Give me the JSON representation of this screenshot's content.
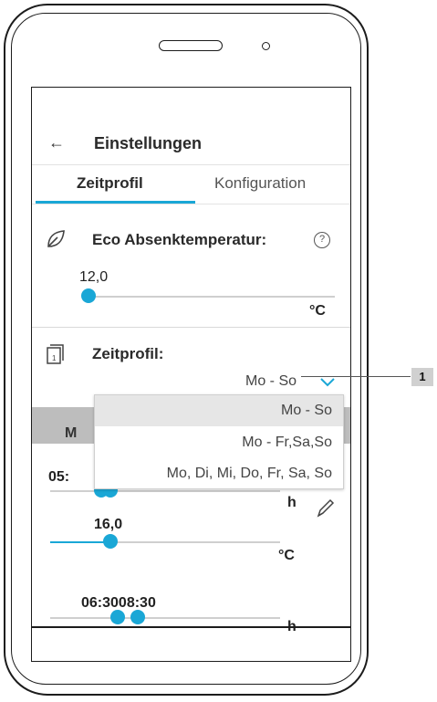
{
  "header": {
    "back_icon": "arrow-left-icon",
    "title": "Einstellungen"
  },
  "tabs": [
    {
      "label": "Zeitprofil",
      "active": true
    },
    {
      "label": "Konfiguration",
      "active": false
    }
  ],
  "eco": {
    "label": "Eco Absenktemperatur:",
    "value": "12,0",
    "unit": "°C",
    "icon": "leaf-icon",
    "help_icon": "question-icon",
    "help_glyph": "?"
  },
  "zeitprofil": {
    "label": "Zeitprofil:",
    "icon": "calendar-icon",
    "selected": "Mo - So",
    "options": [
      "Mo - So",
      "Mo - Fr,Sa,So",
      "Mo, Di, Mi, Do, Fr, Sa, So"
    ]
  },
  "day_header": "M",
  "period1": {
    "time": "05:",
    "unit": "h"
  },
  "period2": {
    "temp": "16,0",
    "unit": "°C"
  },
  "period3": {
    "time": "06:3008:30",
    "unit": "h"
  },
  "callout": {
    "number": "1"
  },
  "colors": {
    "accent": "#1aa7d6",
    "header_gray": "#bdbdbd"
  }
}
